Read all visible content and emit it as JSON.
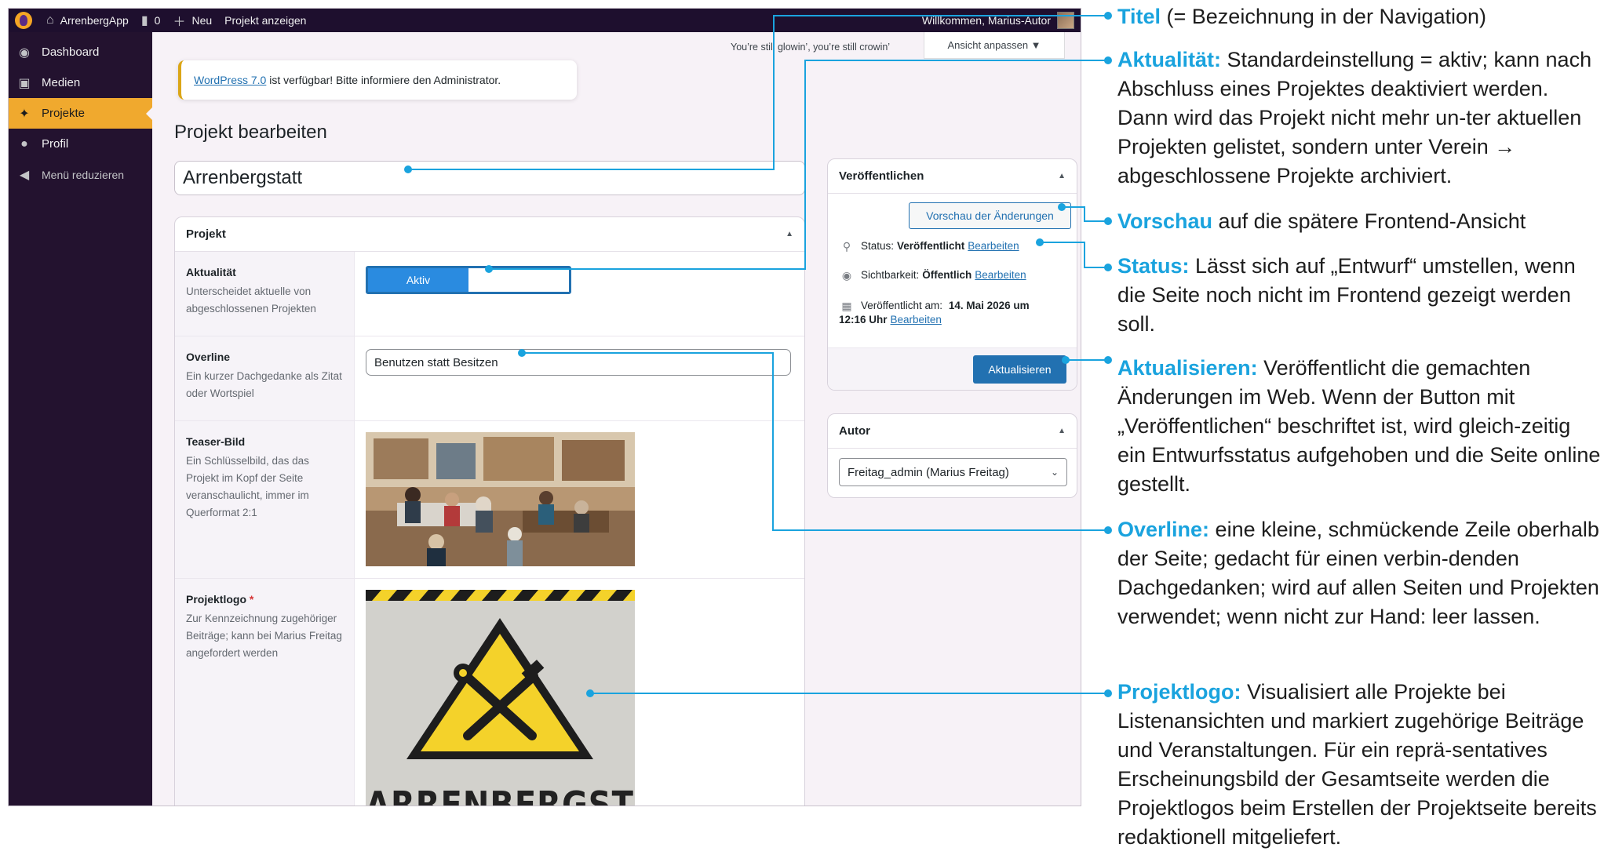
{
  "adminbar": {
    "site_name": "ArrenbergApp",
    "comments_count": "0",
    "new_label": "Neu",
    "view_label": "Projekt anzeigen",
    "greeting": "Willkommen, Marius-Autor"
  },
  "sidebar": {
    "items": [
      {
        "label": "Dashboard",
        "icon": "dashboard-icon"
      },
      {
        "label": "Medien",
        "icon": "media-icon"
      },
      {
        "label": "Projekte",
        "icon": "pin-icon"
      },
      {
        "label": "Profil",
        "icon": "user-icon"
      },
      {
        "label": "Menü reduzieren",
        "icon": "collapse-icon"
      }
    ]
  },
  "screen": {
    "hello_text": "You’re still glowin’, you’re still crowin’",
    "options_label": "Ansicht anpassen ▼"
  },
  "notice": {
    "link": "WordPress 7.0",
    "text": " ist verfügbar! Bitte informiere den Administrator."
  },
  "page": {
    "title": "Projekt bearbeiten",
    "post_title": "Arrenbergstatt"
  },
  "projekt_box": {
    "title": "Projekt",
    "fields": {
      "aktualitaet": {
        "label": "Aktualität",
        "desc": "Unterscheidet aktuelle von abgeschlossenen Projekten",
        "toggle_on": "Aktiv"
      },
      "overline": {
        "label": "Overline",
        "desc": "Ein kurzer Dachgedanke als Zitat oder Wortspiel",
        "value": "Benutzen statt Besitzen"
      },
      "teaser": {
        "label": "Teaser-Bild",
        "desc": "Ein Schlüsselbild, das das Projekt im Kopf der Seite veranschaulicht, immer im Querformat 2:1"
      },
      "logo": {
        "label": "Projektlogo",
        "required_mark": "*",
        "desc": "Zur Kennzeichnung zugehöriger Beiträge; kann bei Marius Freitag angefordert werden",
        "wordmark": "ARRENBERGSTATT"
      }
    }
  },
  "publish_box": {
    "title": "Veröffentlichen",
    "preview_button": "Vorschau der Änderungen",
    "status_label": "Status:",
    "status_value": "Veröffentlicht",
    "visibility_label": "Sichtbarkeit:",
    "visibility_value": "Öffentlich",
    "published_label": "Veröffentlicht am:",
    "published_date": "14. Mai 2026 um",
    "published_time": "12:16 Uhr",
    "edit_link": "Bearbeiten",
    "update_button": "Aktualisieren"
  },
  "author_box": {
    "title": "Autor",
    "selected": "Freitag_admin (Marius Freitag)"
  },
  "annotations": [
    {
      "key": "Titel",
      "text": " (= Bezeichnung in der Navigation)"
    },
    {
      "key": "Aktualität:",
      "text": " Standardeinstellung = aktiv; kann nach Abschluss eines Projektes deaktiviert werden. Dann wird das Projekt nicht mehr un-ter aktuellen Projekten gelistet, sondern unter Verein → abgeschlossene Projekte archiviert."
    },
    {
      "key": "Vorschau",
      "text": " auf die spätere Frontend-Ansicht"
    },
    {
      "key": "Status:",
      "text": " Lässt sich auf „Entwurf“ umstellen, wenn die Seite noch nicht im Frontend gezeigt werden soll."
    },
    {
      "key": "Aktualisieren:",
      "text": " Veröffentlicht die gemachten Änderungen im Web. Wenn der Button mit „Veröffentlichen“ beschriftet ist, wird gleich-zeitig ein Entwurfsstatus aufgehoben und die Seite online gestellt."
    },
    {
      "key": "Overline:",
      "text": " eine kleine, schmückende Zeile oberhalb der Seite; gedacht für einen verbin-denden Dachgedanken; wird auf allen Seiten und Projekten verwendet; wenn nicht zur Hand: leer lassen."
    },
    {
      "key": "Projektlogo:",
      "text": " Visualisiert alle Projekte bei Listenansichten und markiert zugehörige Beiträge und Veranstaltungen. Für ein reprä-sentatives Erscheinungsbild der Gesamtseite werden die Projektlogos beim Erstellen der Projektseite bereits redaktionell mitgeliefert."
    }
  ],
  "colors": {
    "accent": "#1aa3de",
    "admin_bar": "#1e0f2e",
    "menu_current": "#f0a92e",
    "button_primary": "#2271b1"
  }
}
